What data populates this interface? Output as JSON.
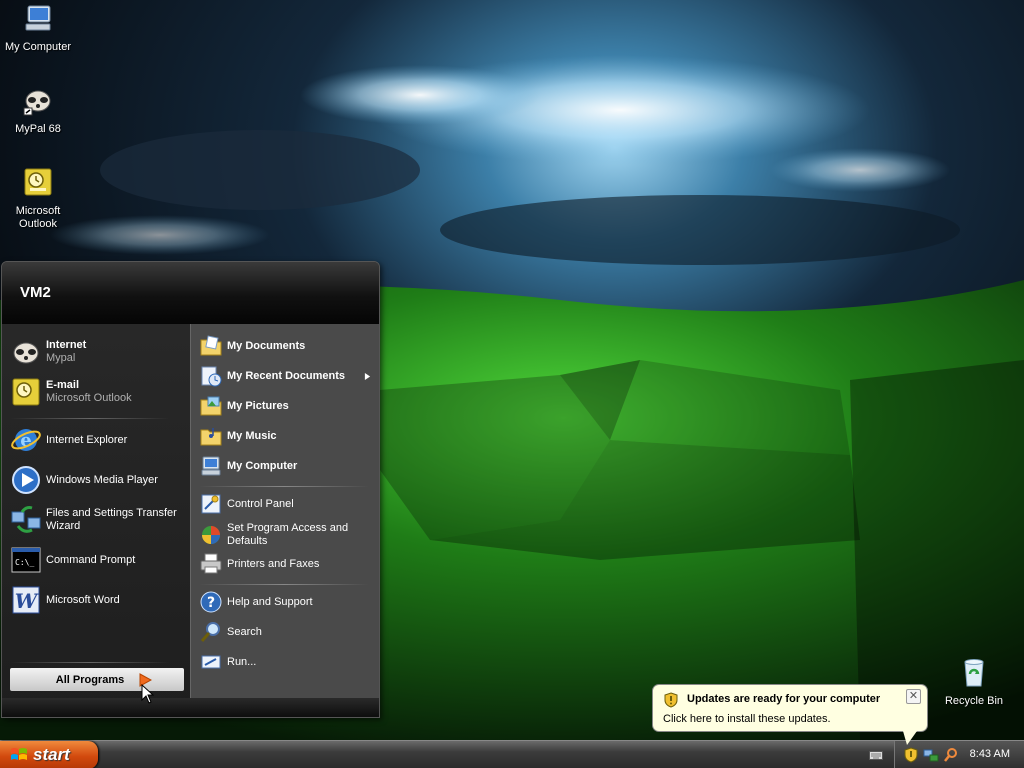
{
  "desktop": {
    "icons": [
      {
        "label": "My Computer"
      },
      {
        "label": "MyPal 68"
      },
      {
        "label": "Microsoft Outlook"
      },
      {
        "label": "Recycle Bin"
      }
    ]
  },
  "start_menu": {
    "user": "VM2",
    "pinned": [
      {
        "title": "Internet",
        "subtitle": "Mypal"
      },
      {
        "title": "E-mail",
        "subtitle": "Microsoft Outlook"
      }
    ],
    "recent": [
      {
        "label": "Internet Explorer"
      },
      {
        "label": "Windows Media Player"
      },
      {
        "label": "Files and Settings Transfer Wizard"
      },
      {
        "label": "Command Prompt"
      },
      {
        "label": "Microsoft Word"
      }
    ],
    "all_programs": "All Programs",
    "places": [
      {
        "label": "My Documents"
      },
      {
        "label": "My Recent Documents"
      },
      {
        "label": "My Pictures"
      },
      {
        "label": "My Music"
      },
      {
        "label": "My Computer"
      }
    ],
    "settings": [
      {
        "label": "Control Panel"
      },
      {
        "label": "Set Program Access and Defaults"
      },
      {
        "label": "Printers and Faxes"
      }
    ],
    "tools": [
      {
        "label": "Help and Support"
      },
      {
        "label": "Search"
      },
      {
        "label": "Run..."
      }
    ]
  },
  "taskbar": {
    "start_label": "start",
    "clock": "8:43 AM"
  },
  "balloon": {
    "title": "Updates are ready for your computer",
    "message": "Click here to install these updates.",
    "close": "✕"
  }
}
